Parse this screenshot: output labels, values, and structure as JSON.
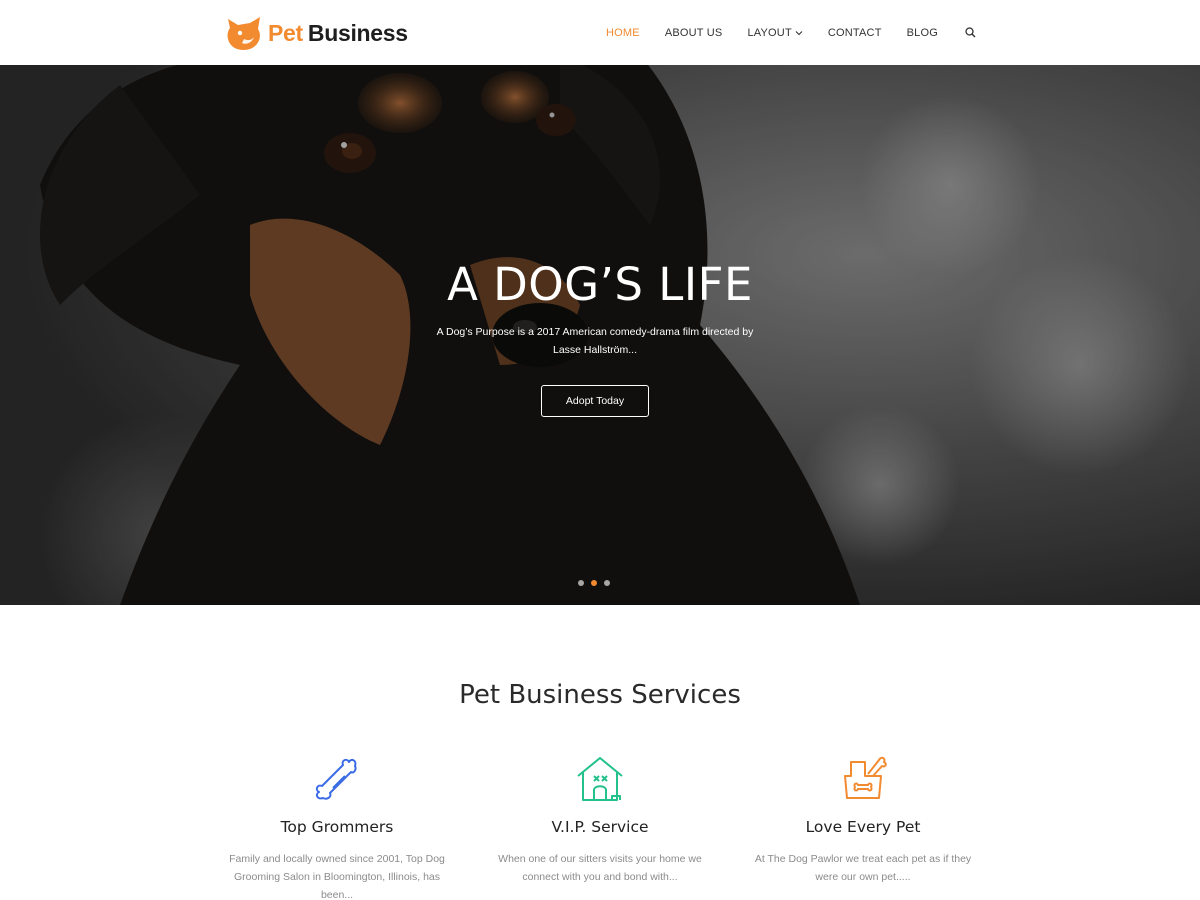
{
  "header": {
    "logo_word_a": "Pet",
    "logo_word_b": "Business",
    "nav": {
      "home": "HOME",
      "about": "ABOUT US",
      "layout": "LAYOUT",
      "contact": "CONTACT",
      "blog": "BLOG"
    },
    "accent_color": "#f28a30"
  },
  "hero": {
    "title": "A DOG’S LIFE",
    "subtitle": "A Dog’s Purpose is a 2017 American comedy-drama film directed by Lasse Hallström...",
    "button_label": "Adopt Today",
    "slide_count": 3,
    "active_slide": 2
  },
  "services": {
    "title": "Pet Business Services",
    "items": [
      {
        "icon": "bone-icon",
        "name": "Top Grommers",
        "desc": "Family and locally owned since 2001, Top Dog Grooming Salon in Bloomington, Illinois, has been...",
        "color": "#3b6be5"
      },
      {
        "icon": "dog-house-icon",
        "name": "V.I.P. Service",
        "desc": "When one of our sitters visits your home we connect with you and bond with...",
        "color": "#22c28a"
      },
      {
        "icon": "food-bowl-icon",
        "name": "Love Every Pet",
        "desc": "At The Dog Pawlor we treat each pet as if they were our own pet.....",
        "color": "#f28a30"
      }
    ]
  }
}
